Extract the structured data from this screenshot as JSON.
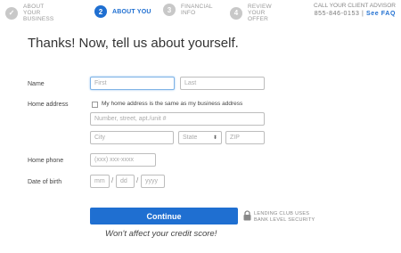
{
  "steps": [
    {
      "number": "✓",
      "label": "ABOUT YOUR BUSINESS",
      "state": "done"
    },
    {
      "number": "2",
      "label": "ABOUT YOU",
      "state": "active"
    },
    {
      "number": "3",
      "label": "FINANCIAL INFO",
      "state": "todo"
    },
    {
      "number": "4",
      "label": "REVIEW YOUR OFFER",
      "state": "todo"
    }
  ],
  "contact": {
    "line1": "CALL YOUR CLIENT ADVISOR",
    "phone": "855-846-0153",
    "separator": "|",
    "faq": "See FAQ"
  },
  "heading": "Thanks! Now, tell us about yourself.",
  "form": {
    "name_label": "Name",
    "first_placeholder": "First",
    "last_placeholder": "Last",
    "address_label": "Home address",
    "same_address_label": "My home address is the same as my business address",
    "street_placeholder": "Number, street, apt./unit #",
    "city_placeholder": "City",
    "state_value": "State",
    "zip_placeholder": "ZIP",
    "phone_label": "Home phone",
    "phone_placeholder": "(xxx) xxx-xxxx",
    "dob_label": "Date of birth",
    "mm_placeholder": "mm",
    "dd_placeholder": "dd",
    "yyyy_placeholder": "yyyy",
    "date_separator": "/"
  },
  "continue_label": "Continue",
  "security_line1": "LENDING CLUB USES",
  "security_line2": "BANK LEVEL SECURITY",
  "credit_note": "Won't affect your credit score!",
  "colors": {
    "accent": "#1f6fd1",
    "inactive": "#c8c8c8"
  }
}
